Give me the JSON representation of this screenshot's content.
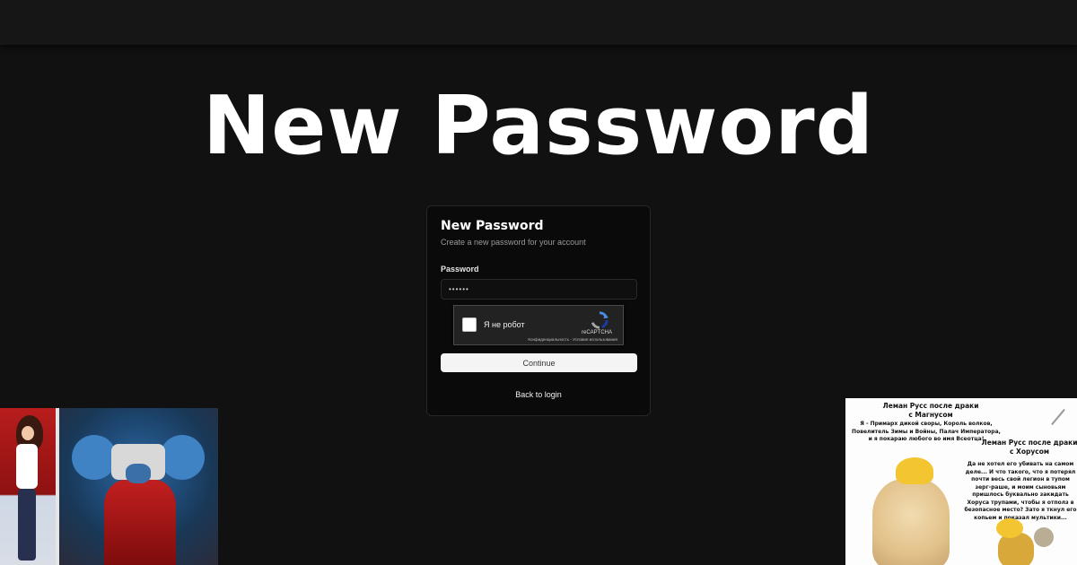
{
  "hero": {
    "title": "New Password"
  },
  "card": {
    "title": "New Password",
    "subtitle": "Create a new password for your account",
    "password_label": "Password",
    "password_value": "••••••",
    "continue_label": "Continue",
    "back_label": "Back to login"
  },
  "captcha": {
    "label": "Я не робот",
    "brand": "reCAPTCHA",
    "links": "Конфиденциальность - Условия использования"
  },
  "meme": {
    "title_1": "Леман Русс после драки с Магнусом",
    "text_1": "Я - Примарх дикой своры, Король волков, Повелитель Зимы и Войны, Палач Императора, и я покараю любого во имя Всеотца!",
    "title_2": "Леман Русс после драки с Хорусом",
    "text_2": "Да не хотел его убивать на самом деле... И что такого, что я потерял почти весь свой легион в тупом зерг-раше, и моим сыновьям пришлось буквально закидать Хоруса трупами, чтобы я отполз в безопасное место? Зато я ткнул его копьем и показал мультики..."
  },
  "colors": {
    "background": "#111111",
    "card_bg": "#0a0a0a",
    "button_bg": "#f4f4f4",
    "accent_blue": "#4a90e2"
  }
}
